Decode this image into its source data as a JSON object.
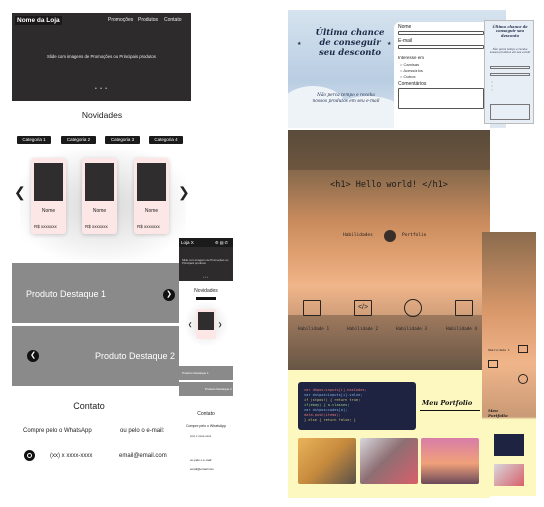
{
  "loja": {
    "brand": "Nome da Loja",
    "nav": [
      "Promoções",
      "Produtos",
      "Contato"
    ],
    "slide_text": "Slide com imagens de Promoções ou Principais produtos",
    "slide_dots": "• • •",
    "novidades_title": "Novidades",
    "categories": [
      "Categoria 1",
      "Categoria 2",
      "Categoria 3",
      "Categoria 4"
    ],
    "prev_arrow": "❮",
    "next_arrow": "❯",
    "products": [
      {
        "name": "Nome",
        "price": "R$ xxxxxxx"
      },
      {
        "name": "Nome",
        "price": "R$ xxxxxxx"
      },
      {
        "name": "Nome",
        "price": "R$ xxxxxxx"
      }
    ],
    "destaque_1": "Produto Destaque 1",
    "destaque_2": "Produto Destaque 2",
    "contato_title": "Contato",
    "whatsapp_label": "Compre pelo o WhatsApp",
    "email_label": "ou pelo o e-mail:",
    "phone_number": "(xx) x xxxx-xxxx",
    "email": "email@email.com"
  },
  "phone_mockup": {
    "title": "Loja X",
    "status_icons": "⚙ ▤ ✆",
    "slide_text": "Slide com imagens de Promoções ou Principais produtos",
    "novidades": "Novidades",
    "destaque_1": "Produto Destaque 1",
    "destaque_2": "Produto Destaque 2",
    "contato": "Contato",
    "whatsapp": "Compre pelo o WhatsApp",
    "phone": "(xx) x xxxx-xxxx",
    "email_label": "ou pelo o e-mail",
    "email": "email@email.com"
  },
  "form_mock": {
    "heading": "Última chance de conseguir seu desconto",
    "subtext": "Não perca tempo e receba nossos produtos em seu e-mail",
    "fields": [
      "Nome",
      "E-mail"
    ],
    "interest_label": "Interesse em",
    "options": [
      "Camisas",
      "Acessórios",
      "Outros"
    ],
    "comments_label": "Comentários",
    "mobile_heading": "Última chance de conseguir seu desconto",
    "mobile_subtext": "Não perca tempo e receba nossos produtos em seu e-mail"
  },
  "portfolio": {
    "hello": "<h1> Hello world! </h1>",
    "toggle_left": "Habilidades",
    "toggle_right": "Portfolio",
    "skills": [
      "Habilidade 1",
      "Habilidade 2",
      "Habilidade 3",
      "Habilidade 4"
    ],
    "portfolio_heading": "Meu Portfolio",
    "mobile_heading": "Meu Portfolio"
  },
  "colors": {
    "loja_dark": "#2d2b2b",
    "card_pink": "#fde6e6",
    "destaque_gray": "#8a8a8a",
    "form_navy": "#1d2a47",
    "portfolio_yellow": "#fdf8bf"
  }
}
